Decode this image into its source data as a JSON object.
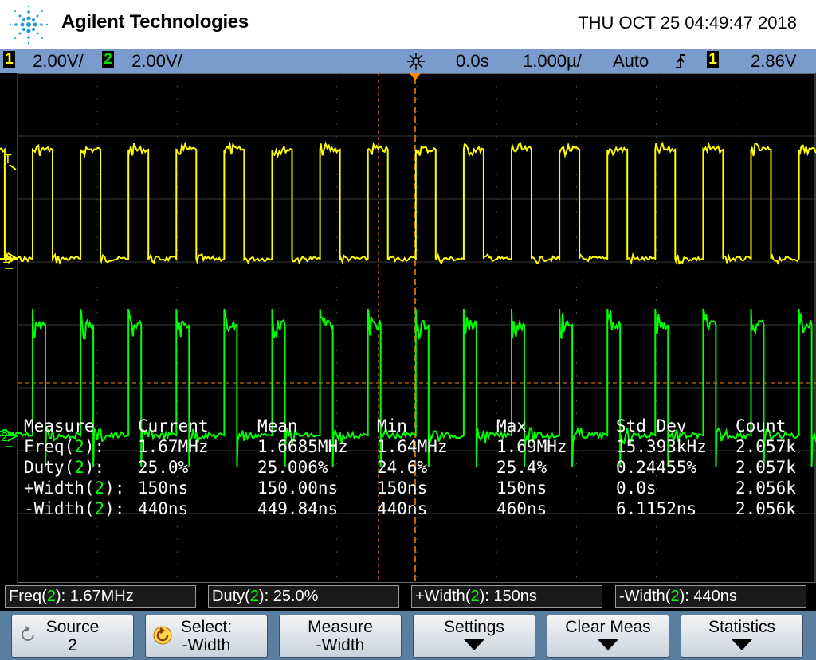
{
  "header": {
    "brand": "Agilent Technologies",
    "datetime": "THU OCT 25 04:49:47 2018"
  },
  "statusbar": {
    "ch1_num": "1",
    "ch1_scale": "2.00V/",
    "ch2_num": "2",
    "ch2_scale": "2.00V/",
    "time_delay": "0.0s",
    "time_scale": "1.000µ/",
    "trigger_mode": "Auto",
    "trigger_slope_icon": "rising-edge",
    "trigger_source": "1",
    "trigger_level": "2.86V"
  },
  "markers": {
    "trigger_marker": "T",
    "ch1_ground": "1",
    "ch2_ground": "2"
  },
  "measurements": {
    "headers": [
      "Measure",
      "Current",
      "Mean",
      "Min",
      "Max",
      "Std Dev",
      "Count"
    ],
    "rows": [
      {
        "name": "Freq",
        "src": "2",
        "suffix": "):",
        "current": "1.67MHz",
        "mean": "1.6685MHz",
        "min": "1.64MHz",
        "max": "1.69MHz",
        "stddev": "15.393kHz",
        "count": "2.057k"
      },
      {
        "name": "Duty",
        "src": "2",
        "suffix": "):",
        "current": "25.0%",
        "mean": "25.006%",
        "min": "24.6%",
        "max": "25.4%",
        "stddev": "0.24455%",
        "count": "2.057k"
      },
      {
        "name": "+Width",
        "src": "2",
        "suffix": "):",
        "current": "150ns",
        "mean": "150.00ns",
        "min": "150ns",
        "max": "150ns",
        "stddev": "0.0s",
        "count": "2.056k"
      },
      {
        "name": "-Width",
        "src": "2",
        "suffix": "):",
        "current": "440ns",
        "mean": "449.84ns",
        "min": "440ns",
        "max": "460ns",
        "stddev": "6.1152ns",
        "count": "2.056k"
      }
    ]
  },
  "readouts": [
    {
      "name": "Freq",
      "src": "2",
      "value": "): 1.67MHz"
    },
    {
      "name": "Duty",
      "src": "2",
      "value": "): 25.0%"
    },
    {
      "name": "+Width",
      "src": "2",
      "value": "): 150ns"
    },
    {
      "name": "-Width",
      "src": "2",
      "value": "): 440ns"
    }
  ],
  "softkeys": [
    {
      "line1": "Source",
      "line2": "2",
      "icon": "rotate-knob-icon"
    },
    {
      "line1": "Select:",
      "line2": "-Width",
      "icon": "rotate-knob-active-icon"
    },
    {
      "line1": "Measure",
      "line2": "-Width"
    },
    {
      "line1": "Settings",
      "arrow": true
    },
    {
      "line1": "Clear Meas",
      "arrow": true
    },
    {
      "line1": "Statistics",
      "arrow": true
    }
  ],
  "colors": {
    "ch1": "#ffff00",
    "ch2": "#00ff00",
    "trigger": "#ff8800",
    "statusbar": "#7a9ccc",
    "softkey_bar": "#5a7ea0"
  }
}
